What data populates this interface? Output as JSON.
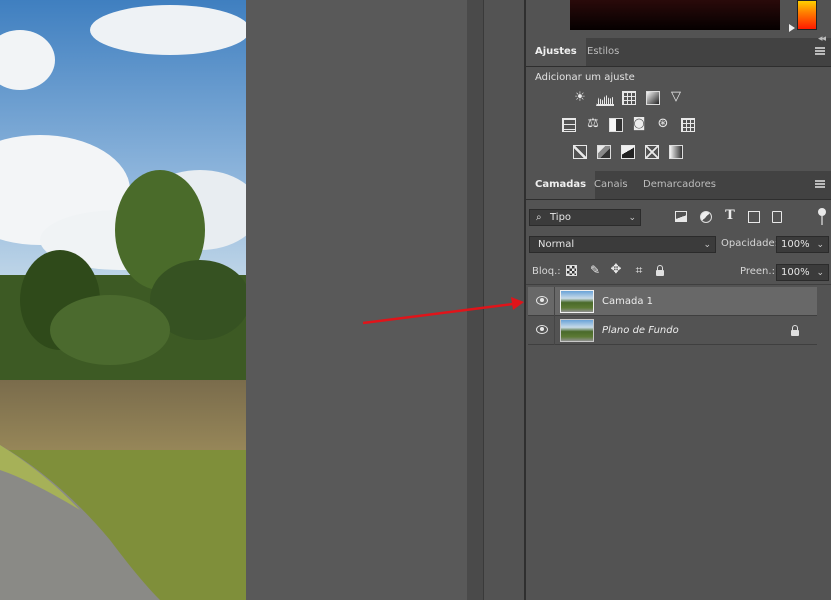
{
  "adjustments_panel": {
    "tabs": [
      "Ajustes",
      "Estilos"
    ],
    "active_tab": "Ajustes",
    "heading": "Adicionar um ajuste",
    "icons_row1": [
      "brightness-contrast-icon",
      "levels-icon",
      "curves-icon",
      "exposure-icon",
      "vibrance-icon"
    ],
    "icons_row2": [
      "hue-saturation-icon",
      "color-balance-icon",
      "black-white-icon",
      "photo-filter-icon",
      "channel-mixer-icon",
      "color-lookup-icon"
    ],
    "icons_row3": [
      "invert-icon",
      "posterize-icon",
      "threshold-icon",
      "selective-color-icon",
      "gradient-map-icon"
    ]
  },
  "layers_panel": {
    "tabs": [
      "Camadas",
      "Canais",
      "Demarcadores"
    ],
    "active_tab": "Camadas",
    "filter_kind": "Tipo",
    "blend_mode": "Normal",
    "opacity_label": "Opacidade:",
    "opacity_value": "100%",
    "lock_label": "Bloq.:",
    "fill_label": "Preen.:",
    "fill_value": "100%",
    "layers": [
      {
        "name": "Camada 1",
        "selected": true,
        "locked": false,
        "italic": false
      },
      {
        "name": "Plano de Fundo",
        "selected": false,
        "locked": true,
        "italic": true
      }
    ]
  },
  "colors": {
    "panel_bg": "#535353",
    "tab_bar_bg": "#424242",
    "selected_layer_bg": "#686868",
    "annotation_arrow": "#e0141a"
  }
}
